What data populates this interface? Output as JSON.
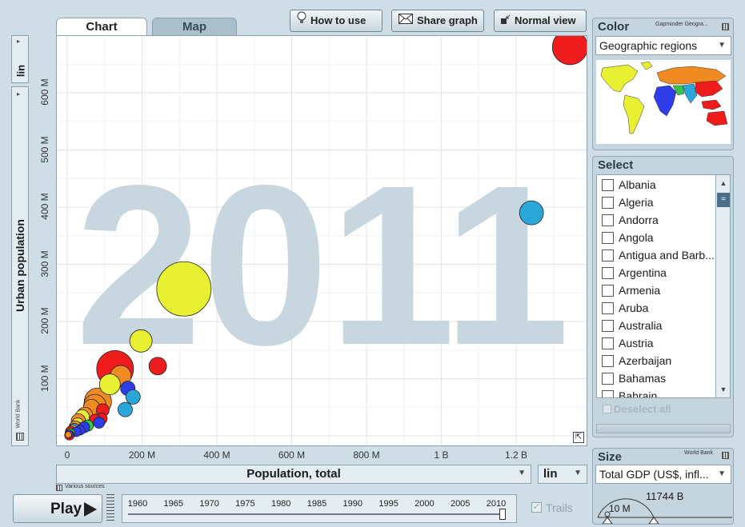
{
  "tabs": {
    "chart": "Chart",
    "map": "Map"
  },
  "toolbar": {
    "how_to_use": "How to use",
    "share_graph": "Share graph",
    "normal_view": "Normal view"
  },
  "y_axis": {
    "scale": "lin",
    "label": "Urban population",
    "source": "World Bank"
  },
  "x_axis": {
    "label": "Population, total",
    "scale": "lin",
    "source": "Various sources"
  },
  "year_watermark": "2011",
  "color_panel": {
    "title": "Color",
    "source": "Gapminder Geogra...",
    "selected": "Geographic regions"
  },
  "select_panel": {
    "title": "Select",
    "items": [
      "Albania",
      "Algeria",
      "Andorra",
      "Angola",
      "Antigua and Barb...",
      "Argentina",
      "Armenia",
      "Aruba",
      "Australia",
      "Austria",
      "Azerbaijan",
      "Bahamas",
      "Bahrain"
    ],
    "deselect": "Deselect all"
  },
  "size_panel": {
    "title": "Size",
    "source": "World Bank",
    "selected": "Total GDP (US$, infl...",
    "min_label": "10 M",
    "max_label": "11744 B"
  },
  "play": {
    "label": "Play",
    "trails_label": "Trails"
  },
  "timeline": {
    "years": [
      "1960",
      "1965",
      "1970",
      "1975",
      "1980",
      "1985",
      "1990",
      "1995",
      "2000",
      "2005",
      "2010"
    ],
    "current": 2011
  },
  "colors": {
    "america": "#e8f032",
    "europe_asia": "#f08a23",
    "africa": "#2e3de8",
    "east_asia": "#ee1c1c",
    "south_asia": "#2aa7d8",
    "mideast": "#34c84a"
  },
  "chart_data": {
    "type": "scatter",
    "xlabel": "Population, total",
    "ylabel": "Urban population",
    "xlim": [
      0,
      1400000000
    ],
    "ylim": [
      0,
      700000000
    ],
    "xticks": [
      "0",
      "200 M",
      "400 M",
      "600 M",
      "800 M",
      "1 B",
      "1.2 B"
    ],
    "yticks": [
      "100 M",
      "200 M",
      "300 M",
      "400 M",
      "500 M",
      "600 M"
    ],
    "points": [
      {
        "x": 1344000000,
        "y": 680000000,
        "size": 22,
        "color": "#ee1c1c"
      },
      {
        "x": 1241000000,
        "y": 390000000,
        "size": 15,
        "color": "#2aa7d8"
      },
      {
        "x": 312000000,
        "y": 257000000,
        "size": 34,
        "color": "#e8f032"
      },
      {
        "x": 197000000,
        "y": 166000000,
        "size": 14,
        "color": "#e8f032"
      },
      {
        "x": 242000000,
        "y": 122000000,
        "size": 11,
        "color": "#ee1c1c"
      },
      {
        "x": 128000000,
        "y": 117000000,
        "size": 23,
        "color": "#ee1c1c"
      },
      {
        "x": 143000000,
        "y": 105000000,
        "size": 13,
        "color": "#f08a23"
      },
      {
        "x": 114000000,
        "y": 90000000,
        "size": 13,
        "color": "#e8f032"
      },
      {
        "x": 162000000,
        "y": 83000000,
        "size": 9,
        "color": "#2e3de8"
      },
      {
        "x": 176000000,
        "y": 68000000,
        "size": 9,
        "color": "#2aa7d8"
      },
      {
        "x": 82000000,
        "y": 60000000,
        "size": 17,
        "color": "#f08a23"
      },
      {
        "x": 74000000,
        "y": 53000000,
        "size": 14,
        "color": "#f08a23"
      },
      {
        "x": 155000000,
        "y": 46000000,
        "size": 9,
        "color": "#2aa7d8"
      },
      {
        "x": 95000000,
        "y": 45000000,
        "size": 8,
        "color": "#ee1c1c"
      },
      {
        "x": 65000000,
        "y": 50000000,
        "size": 10,
        "color": "#f08a23"
      },
      {
        "x": 62000000,
        "y": 38000000,
        "size": 11,
        "color": "#e8f032"
      },
      {
        "x": 92000000,
        "y": 30000000,
        "size": 7,
        "color": "#ee1c1c"
      },
      {
        "x": 47000000,
        "y": 36000000,
        "size": 10,
        "color": "#f08a23"
      },
      {
        "x": 40000000,
        "y": 33000000,
        "size": 9,
        "color": "#e8f032"
      },
      {
        "x": 74000000,
        "y": 28000000,
        "size": 7,
        "color": "#ee1c1c"
      },
      {
        "x": 85000000,
        "y": 23000000,
        "size": 7,
        "color": "#2e3de8"
      },
      {
        "x": 30000000,
        "y": 26000000,
        "size": 9,
        "color": "#f08a23"
      },
      {
        "x": 28000000,
        "y": 20000000,
        "size": 8,
        "color": "#e8f032"
      },
      {
        "x": 55000000,
        "y": 18000000,
        "size": 7,
        "color": "#34c84a"
      },
      {
        "x": 45000000,
        "y": 15000000,
        "size": 7,
        "color": "#2e3de8"
      },
      {
        "x": 22000000,
        "y": 15000000,
        "size": 8,
        "color": "#f08a23"
      },
      {
        "x": 18000000,
        "y": 12000000,
        "size": 7,
        "color": "#2aa7d8"
      },
      {
        "x": 35000000,
        "y": 10000000,
        "size": 6,
        "color": "#2e3de8"
      },
      {
        "x": 14000000,
        "y": 9000000,
        "size": 7,
        "color": "#e8f032"
      },
      {
        "x": 10000000,
        "y": 7000000,
        "size": 7,
        "color": "#ee1c1c"
      },
      {
        "x": 24000000,
        "y": 7000000,
        "size": 6,
        "color": "#2e3de8"
      },
      {
        "x": 8000000,
        "y": 4000000,
        "size": 6,
        "color": "#34c84a"
      },
      {
        "x": 5000000,
        "y": 3000000,
        "size": 5,
        "color": "#2e3de8"
      },
      {
        "x": 6000000,
        "y": 1000000,
        "size": 6,
        "color": "#ee1c1c"
      },
      {
        "x": 3000000,
        "y": 2000000,
        "size": 4,
        "color": "#f08a23"
      }
    ]
  }
}
